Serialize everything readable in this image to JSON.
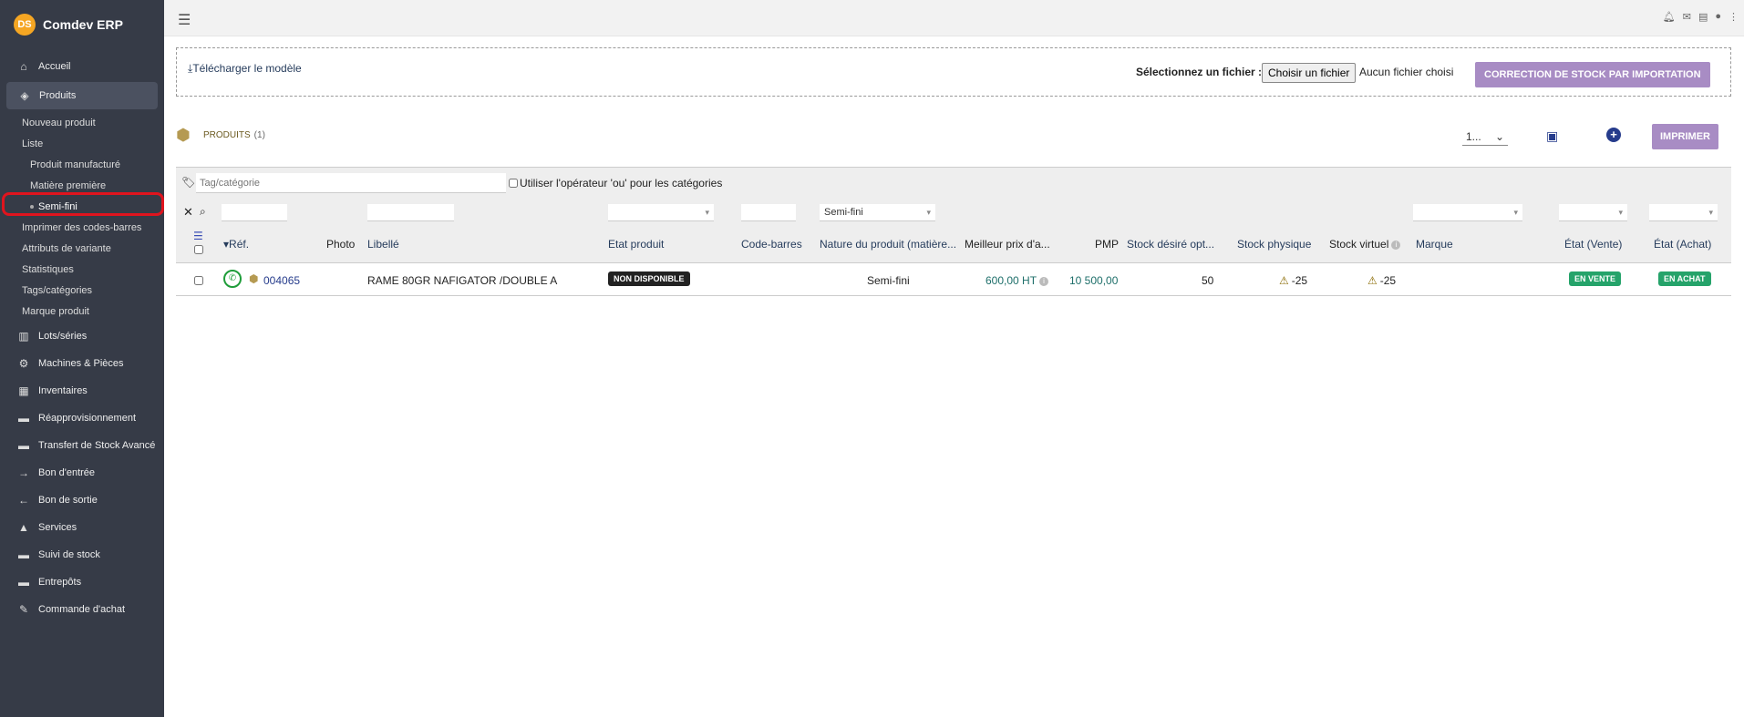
{
  "app": {
    "name": "Comdev ERP",
    "logo_text": "DS"
  },
  "sidebar": {
    "items": [
      {
        "label": "Accueil",
        "icon": "home-icon"
      },
      {
        "label": "Produits",
        "icon": "box-icon"
      }
    ],
    "sub_items": [
      {
        "label": "Nouveau produit"
      },
      {
        "label": "Liste"
      },
      {
        "label": "Produit manufacturé"
      },
      {
        "label": "Matière première"
      },
      {
        "label": "Semi-fini"
      },
      {
        "label": "Imprimer des codes-barres"
      },
      {
        "label": "Attributs de variante"
      },
      {
        "label": "Statistiques"
      },
      {
        "label": "Tags/catégories"
      },
      {
        "label": "Marque produit"
      }
    ],
    "more_items": [
      {
        "label": "Lots/séries",
        "icon": "barcode-icon"
      },
      {
        "label": "Machines & Pièces",
        "icon": "cogs-icon"
      },
      {
        "label": "Inventaires",
        "icon": "boxes-icon"
      },
      {
        "label": "Réapprovisionnement",
        "icon": "truck-icon"
      },
      {
        "label": "Transfert de Stock Avancé",
        "icon": "truck-icon"
      },
      {
        "label": "Bon d'entrée",
        "icon": "arrow-right-icon"
      },
      {
        "label": "Bon de sortie",
        "icon": "arrow-left-icon"
      },
      {
        "label": "Services",
        "icon": "services-icon"
      },
      {
        "label": "Suivi de stock",
        "icon": "truck-icon"
      },
      {
        "label": "Entrepôts",
        "icon": "warehouse-icon"
      },
      {
        "label": "Commande d'achat",
        "icon": "cart-icon"
      }
    ]
  },
  "import": {
    "download_label": "Télécharger le modèle",
    "file_label": "Sélectionnez un fichier :",
    "file_button": "Choisir un fichier",
    "file_none": "Aucun fichier choisi",
    "import_button": "CORRECTION DE STOCK PAR IMPORTATION"
  },
  "list": {
    "title": "PRODUITS",
    "count": "(1)",
    "pager": "1...",
    "print_button": "IMPRIMER"
  },
  "filters": {
    "tag_placeholder": "Tag/catégorie",
    "or_label": "Utiliser l'opérateur 'ou' pour les catégories",
    "nature_value": "Semi-fini"
  },
  "columns": {
    "ref": "Réf.",
    "photo": "Photo",
    "libelle": "Libellé",
    "etat": "Etat produit",
    "barcode": "Code-barres",
    "nature": "Nature du produit (matière...",
    "best_price": "Meilleur prix d'a...",
    "pmp": "PMP",
    "stock_desired": "Stock désiré opt...",
    "stock_physical": "Stock physique",
    "stock_virtual": "Stock virtuel",
    "brand": "Marque",
    "state_sale": "État (Vente)",
    "state_purchase": "État (Achat)"
  },
  "rows": [
    {
      "ref": "004065",
      "libelle": "RAME 80GR NAFIGATOR /DOUBLE A",
      "etat": "NON DISPONIBLE",
      "nature": "Semi-fini",
      "best_price": "600,00 HT",
      "pmp": "10 500,00",
      "stock_desired": "50",
      "stock_physical": "-25",
      "stock_virtual": "-25",
      "state_sale": "EN VENTE",
      "state_purchase": "EN ACHAT"
    }
  ],
  "colors": {
    "sidebar": "#363b47",
    "accent": "#a88cc4",
    "highlight": "#e0141e",
    "badge_green": "#25a36a"
  }
}
